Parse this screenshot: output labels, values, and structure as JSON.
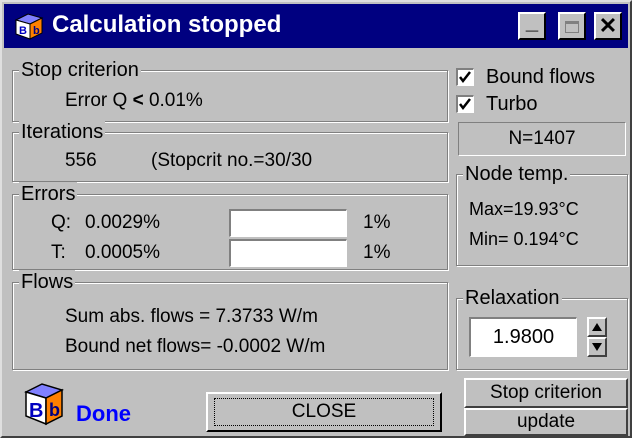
{
  "window": {
    "title": "Calculation stopped",
    "controls": {
      "minimize": "_",
      "close": "✕"
    }
  },
  "stop_criterion": {
    "legend": "Stop criterion",
    "text": "Error Q",
    "operator": "<",
    "value": "0.01%"
  },
  "iterations": {
    "legend": "Iterations",
    "count": "556",
    "detail": "(Stopcrit no.=30/30"
  },
  "errors": {
    "legend": "Errors",
    "rows": [
      {
        "label": "Q:",
        "value": "0.0029%",
        "limit": "1%",
        "fill_fraction": 0
      },
      {
        "label": "T:",
        "value": "0.0005%",
        "limit": "1%",
        "fill_fraction": 0
      }
    ]
  },
  "flows": {
    "legend": "Flows",
    "sum_abs": "Sum abs. flows = 7.3733 W/m",
    "bound_net": "Bound net flows= -0.0002 W/m"
  },
  "options": {
    "bound_flows": {
      "label": "Bound flows",
      "checked": true
    },
    "turbo": {
      "label": "Turbo",
      "checked": true
    }
  },
  "n_display": "N=1407",
  "node_temp": {
    "legend": "Node temp.",
    "max": "Max=19.93°C",
    "min": "Min= 0.194°C"
  },
  "relaxation": {
    "legend": "Relaxation",
    "value": "1.9800"
  },
  "status": {
    "text": "Done",
    "color": "#0000ff"
  },
  "buttons": {
    "close": "CLOSE",
    "stop_criterion": "Stop criterion",
    "update": "update"
  },
  "colors": {
    "titlebar": "#000080",
    "face": "#c0c0c0"
  }
}
